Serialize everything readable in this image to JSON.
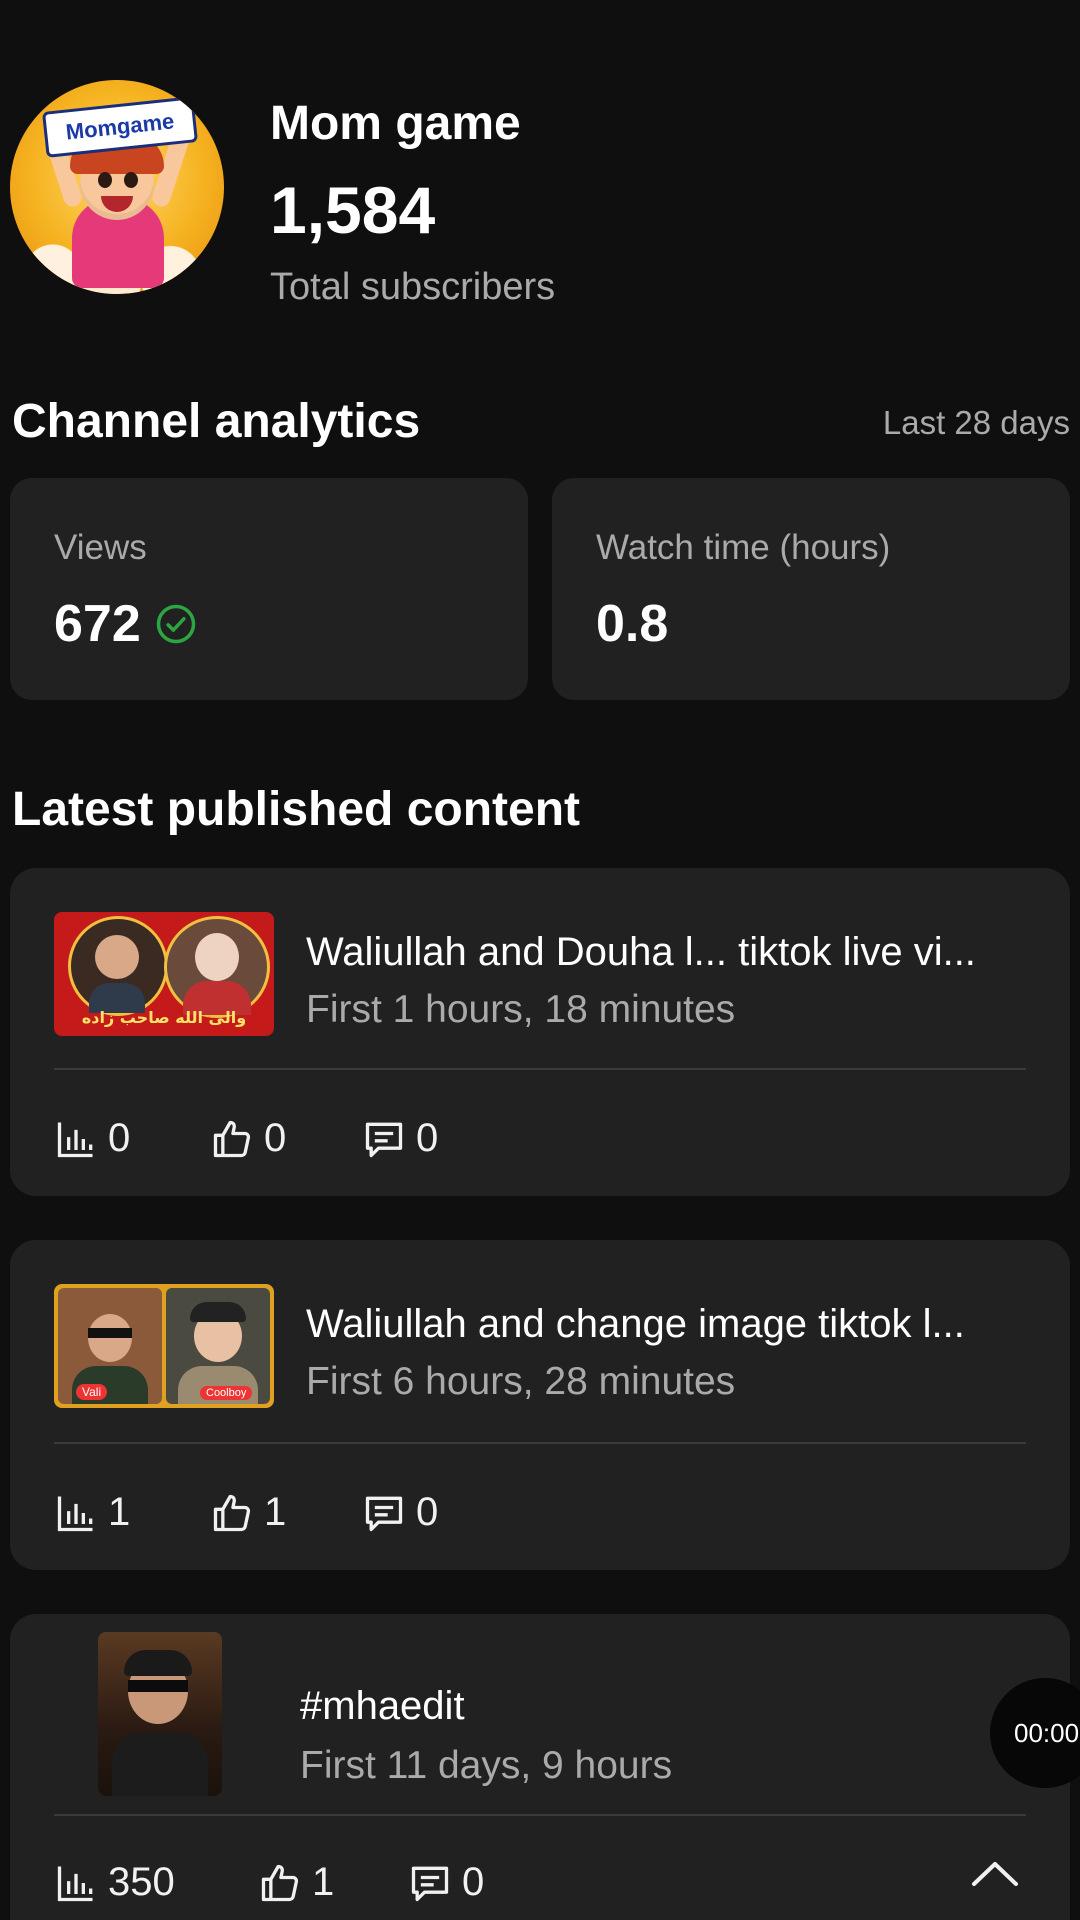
{
  "channel": {
    "name": "Mom game",
    "subscriber_count": "1,584",
    "subscriber_label": "Total subscribers",
    "avatar_sign_text": "Momgame"
  },
  "analytics": {
    "title": "Channel analytics",
    "period": "Last 28 days",
    "cards": [
      {
        "label": "Views",
        "value": "672",
        "icon": "check-circle-icon"
      },
      {
        "label": "Watch time (hours)",
        "value": "0.8"
      }
    ]
  },
  "latest": {
    "title": "Latest published content",
    "items": [
      {
        "title": "Waliullah and Douha l... tiktok live vi...",
        "meta": "First 1 hours, 18 minutes",
        "thumb_caption": "والی الله صاحب زاده",
        "views": "0",
        "likes": "0",
        "comments": "0"
      },
      {
        "title": "Waliullah and change image tiktok l...",
        "meta": "First 6 hours, 28 minutes",
        "thumb_left_tag": "Vali",
        "thumb_right_tag": "Coolboy",
        "views": "1",
        "likes": "1",
        "comments": "0"
      },
      {
        "title": "#mhaedit",
        "meta": "First 11 days, 9 hours",
        "views": "350",
        "likes": "1",
        "comments": "0"
      }
    ]
  },
  "overlay": {
    "time": "00:00"
  },
  "colors": {
    "background": "#0f0f0f",
    "card": "#212121",
    "check_green": "#2ba640",
    "secondary_text": "#aaaaaa"
  }
}
